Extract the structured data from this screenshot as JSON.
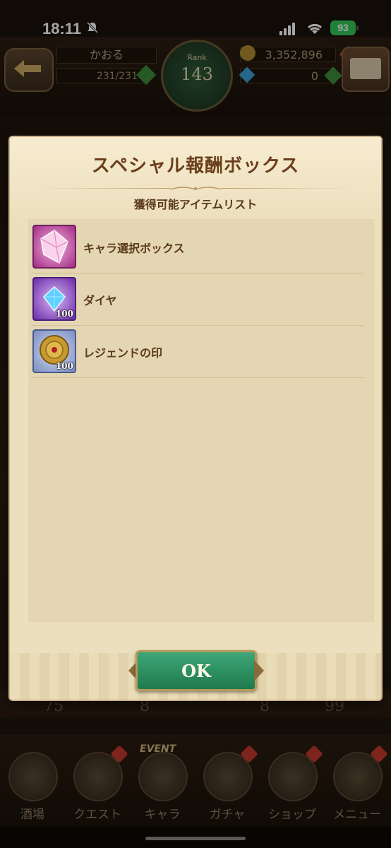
{
  "status_bar": {
    "time": "18:11",
    "battery": "93"
  },
  "header": {
    "player_name": "かおる",
    "stamina": "231/231",
    "rank_label": "Rank",
    "rank_value": "143",
    "gold": "3,352,896",
    "gems": "0"
  },
  "background_counts": [
    "75",
    "8",
    "8",
    "99"
  ],
  "bottom_nav": [
    {
      "label": "酒場",
      "icon": "tavern-icon"
    },
    {
      "label": "クエスト",
      "icon": "quest-scroll-icon"
    },
    {
      "label": "キャラ",
      "icon": "character-icon",
      "badge": "EVENT"
    },
    {
      "label": "ガチャ",
      "icon": "gacha-icon"
    },
    {
      "label": "ショップ",
      "icon": "shop-icon"
    },
    {
      "label": "メニュー",
      "icon": "menu-gear-icon"
    }
  ],
  "dialog": {
    "title": "スペシャル報酬ボックス",
    "subtitle": "獲得可能アイテムリスト",
    "items": [
      {
        "name": "キャラ選択ボックス",
        "qty": "",
        "icon": "character-select-box-icon",
        "color": "#c04aa0"
      },
      {
        "name": "ダイヤ",
        "qty": "100",
        "icon": "diamond-icon",
        "color": "#8a3ec0"
      },
      {
        "name": "レジェンドの印",
        "qty": "100",
        "icon": "legend-seal-icon",
        "color": "#8a9ac8"
      }
    ],
    "ok_label": "OK"
  }
}
